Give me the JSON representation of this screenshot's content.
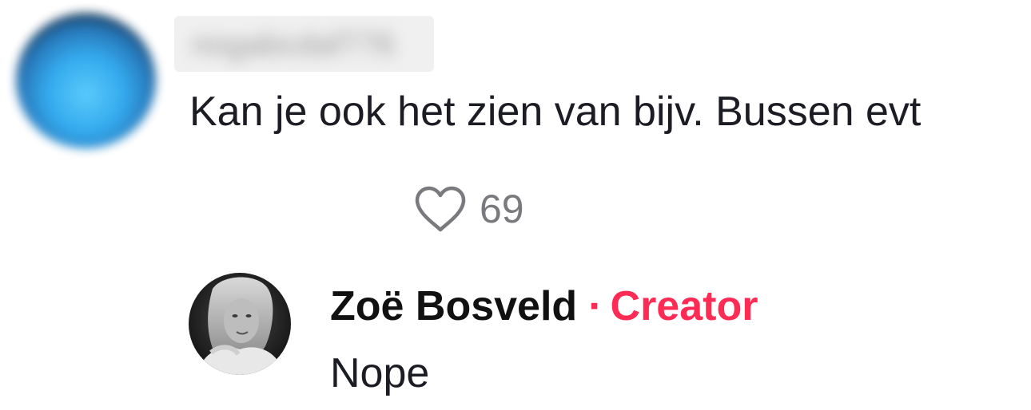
{
  "comment": {
    "username": "nogabcdaf776",
    "text": "Kan je ook het zien van bijv. Bussen evt",
    "like_icon": "heart-outline-icon",
    "like_count": "69"
  },
  "reply": {
    "author": "Zoë Bosveld",
    "separator": "·",
    "badge": "Creator",
    "text": "Nope"
  },
  "colors": {
    "text_primary": "#1c1c24",
    "text_muted": "#7a7a7e",
    "creator_accent": "#fe2c55"
  }
}
